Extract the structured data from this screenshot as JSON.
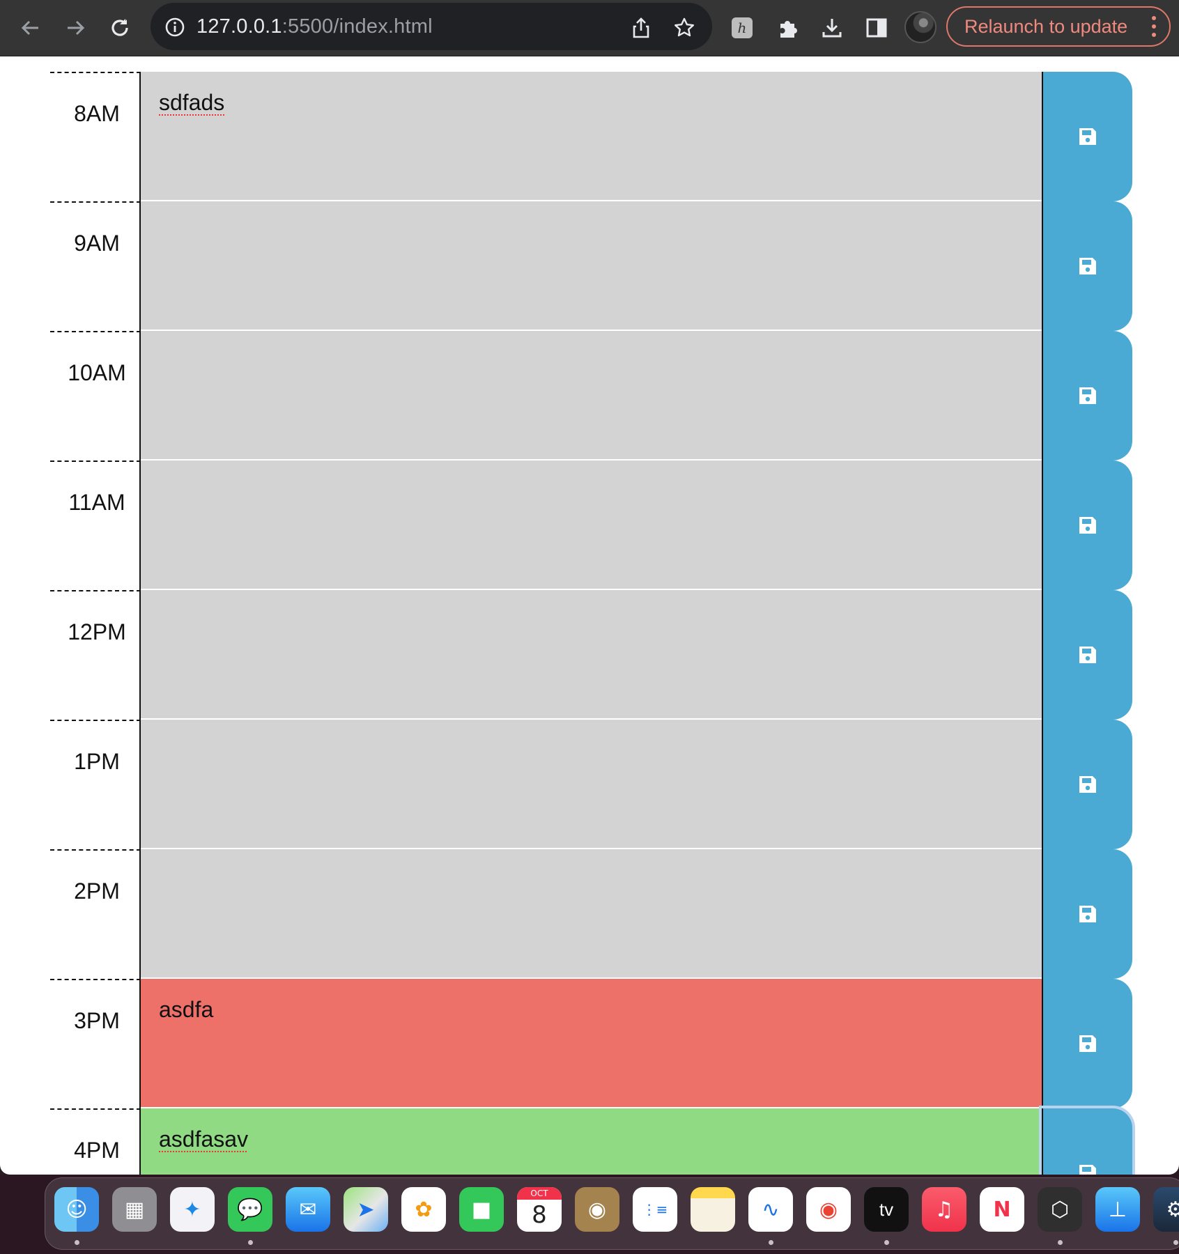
{
  "browser": {
    "url_host": "127.0.0.1",
    "url_rest": ":5500/index.html",
    "relaunch_label": "Relaunch to update"
  },
  "planner": {
    "rows": [
      {
        "hour": "8AM",
        "text": "sdfads",
        "state": "past"
      },
      {
        "hour": "9AM",
        "text": "",
        "state": "past"
      },
      {
        "hour": "10AM",
        "text": "",
        "state": "past"
      },
      {
        "hour": "11AM",
        "text": "",
        "state": "past"
      },
      {
        "hour": "12PM",
        "text": "",
        "state": "past"
      },
      {
        "hour": "1PM",
        "text": "",
        "state": "past"
      },
      {
        "hour": "2PM",
        "text": "",
        "state": "past"
      },
      {
        "hour": "3PM",
        "text": "asdfa",
        "state": "present"
      },
      {
        "hour": "4PM",
        "text": "asdfasav",
        "state": "future"
      }
    ],
    "colors": {
      "past": "#d3d3d3",
      "present": "#ee7169",
      "future": "#8fda82",
      "save": "#4aaad3"
    }
  },
  "dock": {
    "calendar_month": "OCT",
    "calendar_day": "8",
    "tv_label": "tv",
    "apps": [
      "finder-icon",
      "launchpad-icon",
      "safari-icon",
      "messages-icon",
      "mail-icon",
      "maps-icon",
      "photos-icon",
      "facetime-icon",
      "calendar-icon",
      "contacts-icon",
      "reminders-icon",
      "notes-icon",
      "freeform-icon",
      "chrome-icon",
      "appletv-icon",
      "music-icon",
      "news-icon",
      "unity-icon",
      "keynote-icon",
      "steam-icon"
    ]
  }
}
